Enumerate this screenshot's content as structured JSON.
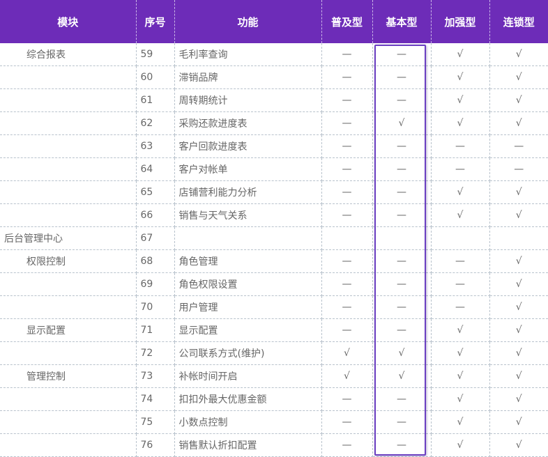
{
  "header": {
    "module": "模块",
    "no": "序号",
    "feature": "功能",
    "tiers": [
      "普及型",
      "基本型",
      "加强型",
      "连锁型"
    ]
  },
  "colors": {
    "header_bg": "#6d2cb8",
    "highlight_border": "#6a3ec1"
  },
  "rows": [
    {
      "module": "综合报表",
      "no": "59",
      "feature": "毛利率查询",
      "marks": [
        "—",
        "—",
        "√",
        "√"
      ]
    },
    {
      "module": "",
      "no": "60",
      "feature": "滞销品牌",
      "marks": [
        "—",
        "—",
        "√",
        "√"
      ]
    },
    {
      "module": "",
      "no": "61",
      "feature": "周转期统计",
      "marks": [
        "—",
        "—",
        "√",
        "√"
      ]
    },
    {
      "module": "",
      "no": "62",
      "feature": "采购还款进度表",
      "marks": [
        "—",
        "√",
        "√",
        "√"
      ]
    },
    {
      "module": "",
      "no": "63",
      "feature": "客户回款进度表",
      "marks": [
        "—",
        "—",
        "—",
        "—"
      ]
    },
    {
      "module": "",
      "no": "64",
      "feature": "客户对帐单",
      "marks": [
        "—",
        "—",
        "—",
        "—"
      ]
    },
    {
      "module": "",
      "no": "65",
      "feature": "店铺营利能力分析",
      "marks": [
        "—",
        "—",
        "√",
        "√"
      ]
    },
    {
      "module": "",
      "no": "66",
      "feature": "销售与天气关系",
      "marks": [
        "—",
        "—",
        "√",
        "√"
      ]
    },
    {
      "module": "后台管理中心",
      "level": "top",
      "no": "67",
      "feature": "",
      "marks": [
        "",
        "",
        "",
        ""
      ]
    },
    {
      "module": "权限控制",
      "no": "68",
      "feature": "角色管理",
      "marks": [
        "—",
        "—",
        "—",
        "√"
      ]
    },
    {
      "module": "",
      "no": "69",
      "feature": "角色权限设置",
      "marks": [
        "—",
        "—",
        "—",
        "√"
      ]
    },
    {
      "module": "",
      "no": "70",
      "feature": "用户管理",
      "marks": [
        "—",
        "—",
        "—",
        "√"
      ]
    },
    {
      "module": "显示配置",
      "no": "71",
      "feature": "显示配置",
      "marks": [
        "—",
        "—",
        "√",
        "√"
      ]
    },
    {
      "module": "",
      "no": "72",
      "feature": "公司联系方式(维护)",
      "marks": [
        "√",
        "√",
        "√",
        "√"
      ]
    },
    {
      "module": "管理控制",
      "no": "73",
      "feature": "补帐时间开启",
      "marks": [
        "√",
        "√",
        "√",
        "√"
      ]
    },
    {
      "module": "",
      "no": "74",
      "feature": "扣扣外最大优惠金额",
      "marks": [
        "—",
        "—",
        "√",
        "√"
      ]
    },
    {
      "module": "",
      "no": "75",
      "feature": "小数点控制",
      "marks": [
        "—",
        "—",
        "√",
        "√"
      ]
    },
    {
      "module": "",
      "no": "76",
      "feature": "销售默认折扣配置",
      "marks": [
        "—",
        "—",
        "√",
        "√"
      ]
    }
  ]
}
